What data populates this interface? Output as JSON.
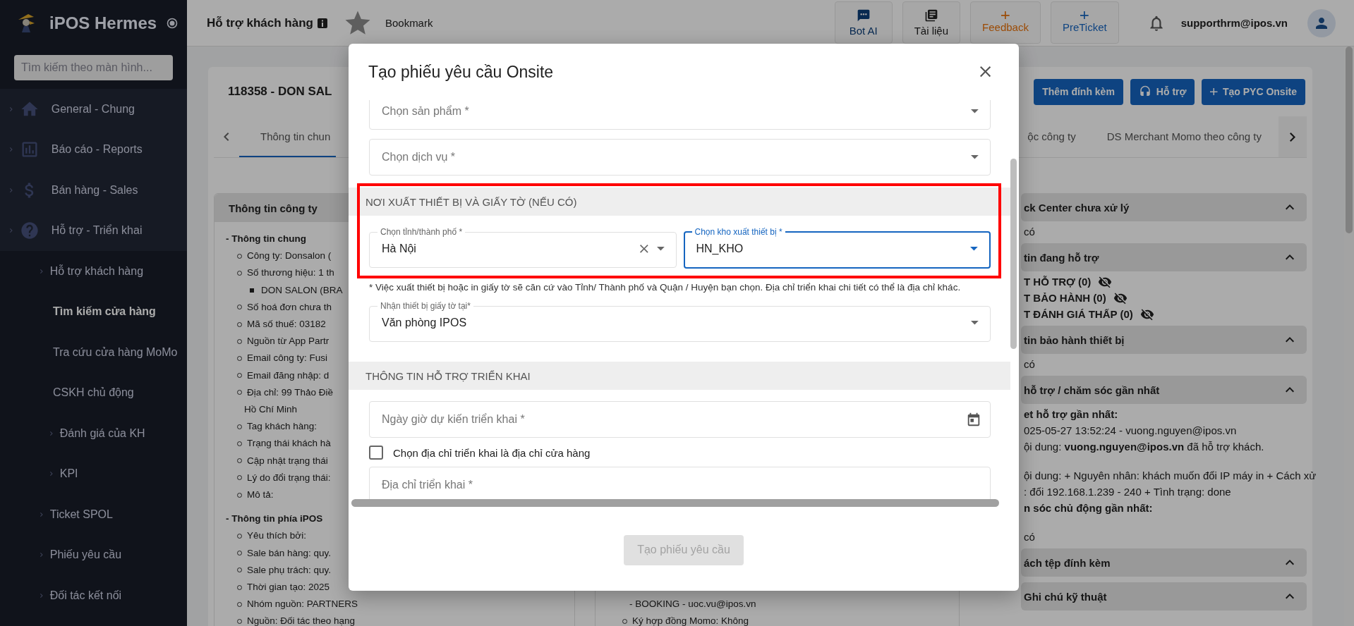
{
  "sidebar": {
    "brand": "iPOS Hermes",
    "search": {
      "placeholder": "Tìm kiếm theo màn hình..."
    },
    "items": [
      {
        "label": "General - Chung",
        "chevron": true,
        "selected": false
      },
      {
        "label": "Báo cáo - Reports",
        "chevron": true,
        "selected": false
      },
      {
        "label": "Bán hàng - Sales",
        "chevron": true,
        "selected": false
      },
      {
        "label": "Hỗ trợ - Triển khai",
        "chevron": true,
        "selected": false,
        "children": [
          {
            "label": "Hỗ trợ khách hàng",
            "chevron": true,
            "selected": false
          },
          {
            "label": "Tìm kiếm cửa hàng",
            "chevron": false,
            "selected": true
          },
          {
            "label": "Tra cứu cửa hàng MoMo",
            "chevron": false,
            "selected": false
          },
          {
            "label": "CSKH chủ động",
            "chevron": false,
            "selected": false,
            "children": [
              {
                "label": "Đánh giá của KH",
                "chevron": true,
                "selected": false
              },
              {
                "label": "KPI",
                "chevron": true,
                "selected": false
              }
            ]
          },
          {
            "label": "Ticket SPOL",
            "chevron": true,
            "selected": false
          },
          {
            "label": "Phiếu yêu cầu",
            "chevron": true,
            "selected": false
          },
          {
            "label": "Đối tác kết nối",
            "chevron": true,
            "selected": false
          }
        ]
      }
    ]
  },
  "header": {
    "title": "Hỗ trợ khách hàng",
    "bookmarked": false,
    "bookmark": "Bookmark",
    "actions": [
      {
        "label": "Bot AI"
      },
      {
        "label": "Tài liệu"
      },
      {
        "label": "Feedback"
      },
      {
        "label": "PreTicket"
      }
    ],
    "user": "supporthrm@ipos.vn"
  },
  "page": {
    "title": "118358 - DON SAL",
    "buttons": [
      {
        "label": "Thêm đính kèm"
      },
      {
        "label": "Hỗ trợ"
      },
      {
        "label": "Tạo PYC Onsite"
      }
    ],
    "tabs": [
      {
        "label": "Thông tin chun",
        "selected": true
      },
      {
        "label": "ộc công ty",
        "selected": false
      },
      {
        "label": "DS Merchant Momo theo công ty",
        "selected": false
      }
    ],
    "company_panel": {
      "title": "Thông tin công ty",
      "lines": [
        {
          "kind": "heading",
          "text": "- Thông tin chung"
        },
        {
          "kind": "item",
          "text": "Công ty: Donsalon ("
        },
        {
          "kind": "item",
          "text": "Số thương hiệu: 1 th"
        },
        {
          "kind": "subitem",
          "text": "DON SALON (BRA"
        },
        {
          "kind": "item",
          "text": "Số hoá đơn chưa th"
        },
        {
          "kind": "item",
          "text": "Mã số thuế: 03182"
        },
        {
          "kind": "item",
          "text": "Nguồn từ App Partr"
        },
        {
          "kind": "item",
          "text": "Email công ty: Fusi"
        },
        {
          "kind": "item",
          "text": "Email đăng nhập: d"
        },
        {
          "kind": "item",
          "text": "Địa chỉ: 99 Thảo Điề"
        },
        {
          "kind": "continuation",
          "text": "Hồ Chí Minh"
        },
        {
          "kind": "item",
          "text": "Tag khách hàng:"
        },
        {
          "kind": "item",
          "text": "Trạng thái khách hà"
        },
        {
          "kind": "item",
          "text": "Cập nhật trạng thái"
        },
        {
          "kind": "item",
          "text": "Lý do đổi trạng thái:"
        },
        {
          "kind": "item",
          "text": "Mô tả:"
        },
        {
          "kind": "heading",
          "text": "- Thông tin phía iPOS"
        },
        {
          "kind": "item",
          "text": "Yêu thích bởi:"
        },
        {
          "kind": "item",
          "text": "Sale bán hàng: quy."
        },
        {
          "kind": "item",
          "text": "Sale phụ trách: quy."
        },
        {
          "kind": "item",
          "text": "Thời gian tạo: 2025"
        },
        {
          "kind": "item",
          "text": "Nhóm nguồn: PARTNERS"
        },
        {
          "kind": "item",
          "text": "Nguồn: Đối tác theo hạng"
        }
      ]
    },
    "middle_panel": {
      "lines": [
        {
          "kind": "continuation",
          "text": "- BOOKING - uoc.vu@ipos.vn"
        },
        {
          "kind": "item",
          "text": "Ký hợp đồng Momo: Không"
        }
      ]
    },
    "right_sections": [
      {
        "title": "ck Center chưa xử lý",
        "expanded": true,
        "lines": [
          {
            "kind": "text",
            "text": "có"
          }
        ]
      },
      {
        "title": "tin đang hỗ trợ",
        "expanded": true,
        "lines": [
          {
            "kind": "hidden_count",
            "text": "T HỖ TRỢ (0)"
          },
          {
            "kind": "hidden_count",
            "text": "T BẢO HÀNH (0)"
          },
          {
            "kind": "hidden_count",
            "text": "T ĐÁNH GIÁ THẤP (0)"
          }
        ]
      },
      {
        "title": "tin bảo hành thiết bị",
        "expanded": true,
        "lines": [
          {
            "kind": "text",
            "text": "có"
          }
        ]
      },
      {
        "title": "hỗ trợ / chăm sóc gần nhất",
        "expanded": true,
        "lines": [
          {
            "kind": "bold",
            "text": "et hỗ trợ gần nhất:"
          },
          {
            "kind": "text",
            "text": "025-05-27 13:52:24 - vuong.nguyen@ipos.vn"
          },
          {
            "kind": "text",
            "text": "ội dung: **vuong.nguyen@ipos.vn** đã hỗ trợ khách."
          },
          {
            "kind": "para",
            "text": "ội dung: + Nguyên nhân: khách muốn đổi IP máy in + Cách xử"
          },
          {
            "kind": "text",
            "text": ": đổi 192.168.1.239 - 240 + Tình trạng: done"
          },
          {
            "kind": "bold",
            "text": "n sóc chủ động gần nhất:"
          },
          {
            "kind": "para",
            "text": "có"
          }
        ]
      },
      {
        "title": "ách tệp đính kèm",
        "expanded": true
      },
      {
        "title": "Ghi chú kỹ thuật",
        "expanded": true
      }
    ]
  },
  "modal": {
    "title": "Tạo phiếu yêu cầu Onsite",
    "fields": [
      {
        "kind": "select",
        "placeholder": "Chọn sản phẩm *",
        "focused": false,
        "clearable": false
      },
      {
        "kind": "select",
        "placeholder": "Chọn dịch vụ *",
        "focused": false,
        "clearable": false
      },
      {
        "kind": "group",
        "highlighted": true,
        "title": "NƠI XUẤT THIẾT BỊ VÀ GIẤY TỜ (NẾU CÓ)",
        "fields": [
          {
            "kind": "select",
            "label": "Chọn tỉnh/thành phố *",
            "value": "Hà Nội",
            "focused": false,
            "clearable": true
          },
          {
            "kind": "select",
            "label": "Chọn kho xuất thiết bị *",
            "value": "HN_KHO",
            "focused": true,
            "clearable": false
          }
        ]
      },
      {
        "kind": "helper",
        "text": "* Việc xuất thiết bị hoặc in giấy tờ sẽ căn cứ vào Tỉnh/ Thành phố và Quận / Huyện bạn chọn. Địa chỉ triển khai chi tiết có thể là địa chỉ khác."
      },
      {
        "kind": "select",
        "label": "Nhận thiết bị giấy tờ tại*",
        "value": "Văn phòng IPOS",
        "focused": false,
        "clearable": false
      },
      {
        "kind": "section",
        "title": "THÔNG TIN HỖ TRỢ TRIỂN KHAI"
      },
      {
        "kind": "date",
        "placeholder": "Ngày giờ dự kiến triển khai *",
        "focused": false
      },
      {
        "kind": "checkbox",
        "label": "Chọn địa chỉ triển khai là địa chỉ cửa hàng",
        "checked": false
      },
      {
        "kind": "text",
        "placeholder": "Địa chỉ triển khai *",
        "focused": false
      }
    ],
    "submit": {
      "label": "Tạo phiếu yêu cầu",
      "disabled": true
    }
  }
}
